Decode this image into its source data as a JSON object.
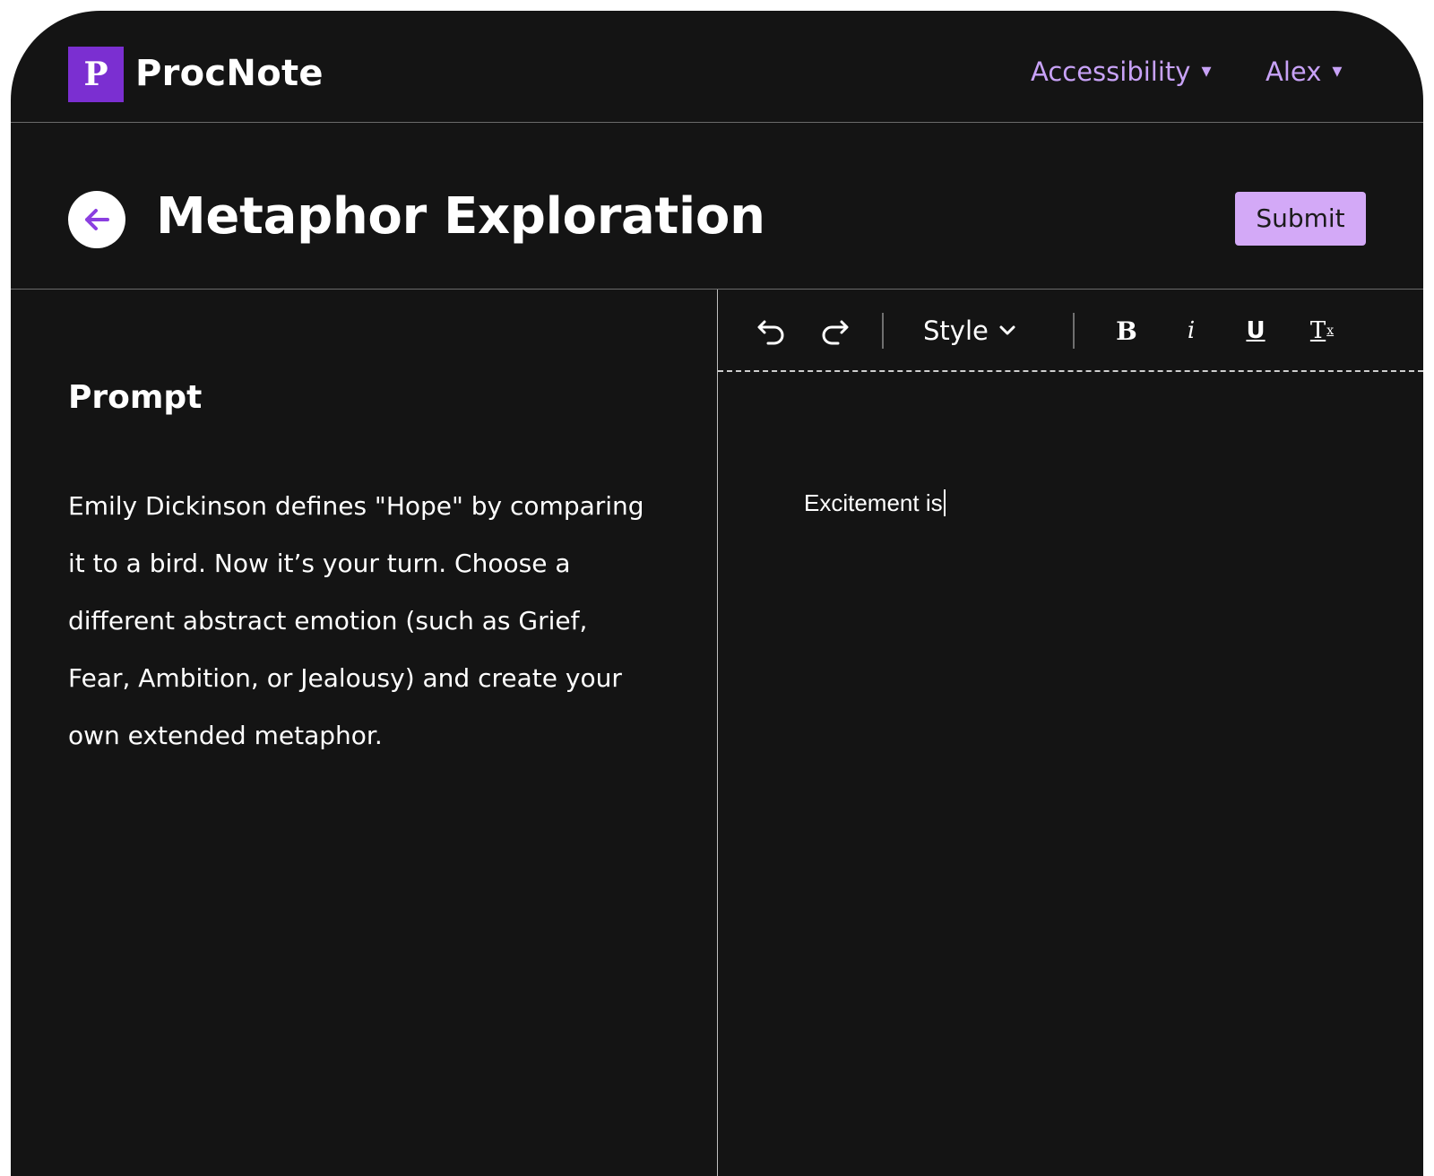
{
  "app": {
    "logo_letter": "P",
    "brand": "ProcNote",
    "brand_color": "#7b2fd1",
    "accent_color": "#c8a2f7"
  },
  "nav": {
    "accessibility_label": "Accessibility",
    "user_name": "Alex",
    "caret": "▾"
  },
  "page": {
    "title": "Metaphor Exploration",
    "back_icon": "arrow-left-icon",
    "submit_label": "Submit",
    "submit_color": "#d3a9f7"
  },
  "prompt": {
    "heading": "Prompt",
    "body": "Emily Dickinson defines \"Hope\" by comparing it to a bird. Now it’s your turn. Choose a different abstract emotion (such as Grief, Fear, Ambition, or Jealousy) and create your own extended metaphor."
  },
  "toolbar": {
    "undo_icon": "undo-icon",
    "redo_icon": "redo-icon",
    "style_label": "Style",
    "bold_label": "B",
    "italic_label": "i",
    "underline_label": "U",
    "clear_format_label": "T",
    "clear_format_sub": "x"
  },
  "editor": {
    "content": "Excitement is"
  }
}
